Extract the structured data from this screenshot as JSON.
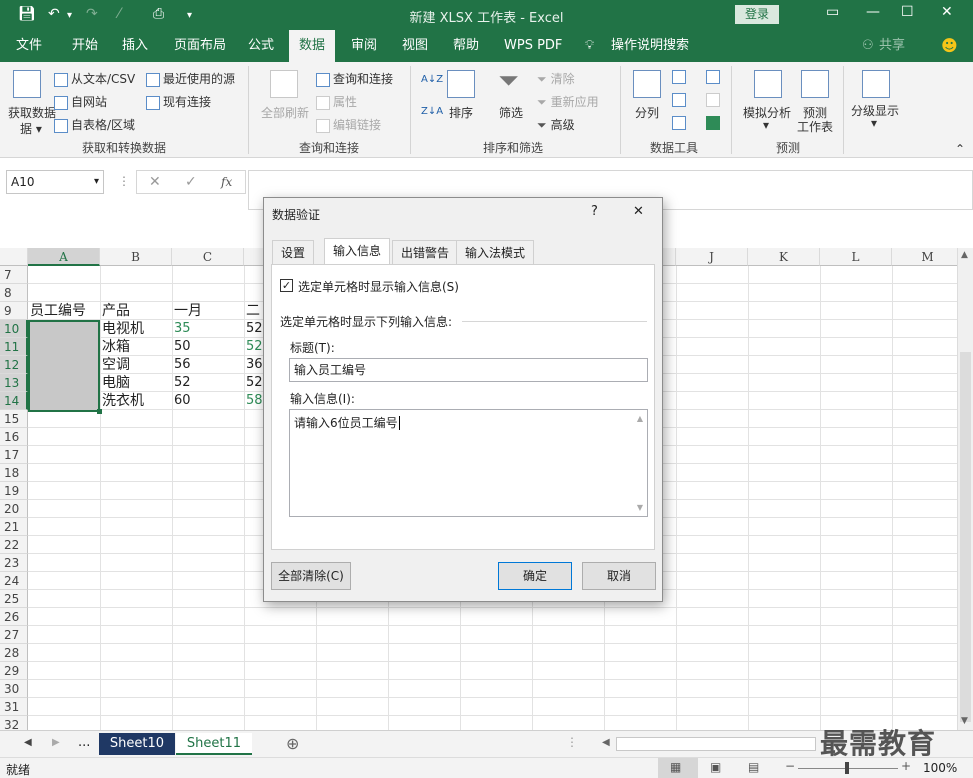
{
  "app": {
    "title": "新建 XLSX 工作表 - Excel",
    "login": "登录",
    "share": "共享"
  },
  "tabs": [
    "文件",
    "开始",
    "插入",
    "页面布局",
    "公式",
    "数据",
    "审阅",
    "视图",
    "帮助",
    "WPS PDF",
    "操作说明搜索"
  ],
  "ribbon": {
    "get_data": "获取数据",
    "get_data_sub": "据",
    "from_text": "从文本/CSV",
    "from_web": "自网站",
    "from_table": "自表格/区域",
    "recent_sources": "最近使用的源",
    "existing_conn": "现有连接",
    "group1": "获取和转换数据",
    "refresh_all": "全部刷新",
    "queries_conn": "查询和连接",
    "properties": "属性",
    "edit_links": "编辑链接",
    "group2": "查询和连接",
    "sort": "排序",
    "filter": "筛选",
    "clear": "清除",
    "reapply": "重新应用",
    "advanced": "高级",
    "group3": "排序和筛选",
    "text_to_cols": "分列",
    "group4": "数据工具",
    "whatif": "模拟分析",
    "forecast": "预测",
    "forecast_sheet": "工作表",
    "group5": "预测",
    "outline": "分级显示"
  },
  "formula_bar": {
    "name_box": "A10",
    "fx": "fx"
  },
  "grid": {
    "columns": [
      "A",
      "B",
      "C",
      "",
      "",
      "",
      "",
      "",
      "",
      "J",
      "K",
      "L",
      "M"
    ],
    "rows": [
      "7",
      "8",
      "9",
      "10",
      "11",
      "12",
      "13",
      "14",
      "15",
      "16",
      "17",
      "18",
      "19",
      "20",
      "21",
      "22",
      "23",
      "24",
      "25",
      "26",
      "27",
      "28",
      "29",
      "30",
      "31",
      "32"
    ],
    "cells": {
      "A9": "员工编号",
      "B9": "产品",
      "C9": "一月",
      "D9": "二",
      "B10": "电视机",
      "C10": "35",
      "D10": "52",
      "B11": "冰箱",
      "C11": "50",
      "D11": "52",
      "B12": "空调",
      "C12": "56",
      "D12": "36",
      "B13": "电脑",
      "C13": "52",
      "D13": "52",
      "B14": "洗衣机",
      "C14": "60",
      "D14": "58"
    },
    "green_color": "#2e8b57"
  },
  "sheets": {
    "ellipsis": "...",
    "tab1": "Sheet10",
    "tab2": "Sheet11",
    "add": "⊕"
  },
  "status": {
    "ready": "就绪",
    "zoom": "100%"
  },
  "dialog": {
    "title": "数据验证",
    "help": "?",
    "close": "✕",
    "tabs": [
      "设置",
      "输入信息",
      "出错警告",
      "输入法模式"
    ],
    "checkbox_label": "选定单元格时显示输入信息(S)",
    "section_label": "选定单元格时显示下列输入信息:",
    "title_label": "标题(T):",
    "title_value": "输入员工编号",
    "message_label": "输入信息(I):",
    "message_value": "请输入6位员工编号",
    "clear_all": "全部清除(C)",
    "ok": "确定",
    "cancel": "取消"
  },
  "watermark": "最需教育",
  "colors": {
    "excel_green": "#217346",
    "ribbon_bg": "#f3f3f3",
    "selected_range": "#c8c8c8",
    "sheet10_bg": "#1f3864"
  }
}
